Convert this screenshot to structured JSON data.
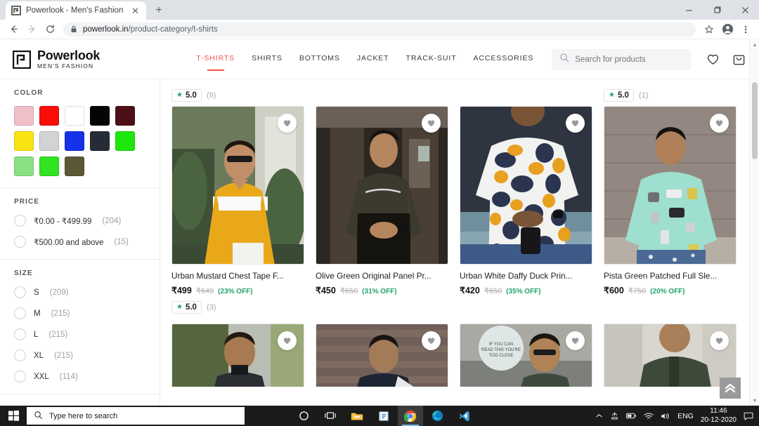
{
  "browser": {
    "tab": {
      "title": "Powerlook - Men's Fashion",
      "favicon_icon": "powerlook-logo-icon",
      "close_icon": "close-icon"
    },
    "new_tab_icon": "plus-icon",
    "window_controls": {
      "minimize": "minimize-icon",
      "maximize": "maximize-icon",
      "close": "close-icon"
    },
    "nav": {
      "back_icon": "arrow-left-icon",
      "forward_icon": "arrow-right-icon",
      "reload_icon": "reload-icon"
    },
    "omnibox": {
      "lock_icon": "lock-icon",
      "host": "powerlook.in",
      "path": "/product-category/t-shirts"
    },
    "toolbar_icons": {
      "bookmark": "star-icon",
      "profile": "account-circle-icon",
      "menu": "three-dot-menu-icon"
    }
  },
  "site": {
    "logo": {
      "name": "Powerlook",
      "tagline": "MEN'S FASHION",
      "mark_icon": "powerlook-monogram-icon"
    },
    "nav_items": [
      {
        "label": "T-SHIRTS",
        "active": true
      },
      {
        "label": "SHIRTS",
        "active": false
      },
      {
        "label": "BOTTOMS",
        "active": false
      },
      {
        "label": "JACKET",
        "active": false
      },
      {
        "label": "TRACK-SUIT",
        "active": false
      },
      {
        "label": "ACCESSORIES",
        "active": false
      }
    ],
    "search": {
      "placeholder": "Search for products",
      "value": "",
      "icon": "search-icon"
    },
    "header_icons": [
      {
        "name": "wishlist-icon"
      },
      {
        "name": "cart-icon"
      }
    ]
  },
  "sidebar": {
    "color": {
      "title": "COLOR",
      "swatches": [
        {
          "name": "pink",
          "hex": "#efc0c8"
        },
        {
          "name": "red",
          "hex": "#fb0d08"
        },
        {
          "name": "white",
          "hex": "#ffffff"
        },
        {
          "name": "black",
          "hex": "#050505"
        },
        {
          "name": "maroon",
          "hex": "#4e1018"
        },
        {
          "name": "yellow",
          "hex": "#f8e412"
        },
        {
          "name": "grey",
          "hex": "#d2d3d5"
        },
        {
          "name": "blue",
          "hex": "#1432e8"
        },
        {
          "name": "navy",
          "hex": "#262b38"
        },
        {
          "name": "green",
          "hex": "#1fe70d"
        },
        {
          "name": "pista-green",
          "hex": "#8ae084"
        },
        {
          "name": "lime-green",
          "hex": "#31e320"
        },
        {
          "name": "olive",
          "hex": "#5c5734"
        }
      ]
    },
    "price": {
      "title": "PRICE",
      "options": [
        {
          "label": "₹0.00 - ₹499.99",
          "count": "(204)"
        },
        {
          "label": "₹500.00 and above",
          "count": "(15)"
        }
      ]
    },
    "size": {
      "title": "SIZE",
      "options": [
        {
          "label": "S",
          "count": "(209)"
        },
        {
          "label": "M",
          "count": "(215)"
        },
        {
          "label": "L",
          "count": "(215)"
        },
        {
          "label": "XL",
          "count": "(215)"
        },
        {
          "label": "XXL",
          "count": "(114)"
        }
      ]
    }
  },
  "main": {
    "top_ratings": [
      {
        "star": "★",
        "value": "5.0",
        "count": "(9)"
      },
      {
        "star": "★",
        "value": "5.0",
        "count": "(1)"
      }
    ],
    "products": [
      {
        "name": "Urban Mustard Chest Tape F...",
        "price": "₹499",
        "mrp": "₹649",
        "discount": "(23% OFF)",
        "rating": {
          "star": "★",
          "value": "5.0",
          "count": "(3)"
        },
        "wishlist_icon": "heart-icon"
      },
      {
        "name": "Olive Green Original Panel Pr...",
        "price": "₹450",
        "mrp": "₹650",
        "discount": "(31% OFF)",
        "rating": null,
        "wishlist_icon": "heart-icon"
      },
      {
        "name": "Urban White Daffy Duck Prin...",
        "price": "₹420",
        "mrp": "₹650",
        "discount": "(35% OFF)",
        "rating": null,
        "wishlist_icon": "heart-icon"
      },
      {
        "name": "Pista Green Patched Full Sle...",
        "price": "₹600",
        "mrp": "₹750",
        "discount": "(20% OFF)",
        "rating": null,
        "wishlist_icon": "heart-icon"
      }
    ],
    "scroll_top_icon": "double-chevron-up-icon"
  },
  "taskbar": {
    "start_icon": "windows-start-icon",
    "search": {
      "placeholder": "Type here to search",
      "icon": "search-icon"
    },
    "apps": [
      {
        "name": "cortana-icon"
      },
      {
        "name": "task-view-icon"
      },
      {
        "name": "file-explorer-icon"
      },
      {
        "name": "microsoft-store-icon"
      },
      {
        "name": "google-chrome-icon",
        "active": true
      },
      {
        "name": "microsoft-edge-icon"
      },
      {
        "name": "vs-code-icon"
      }
    ],
    "tray": {
      "overflow_icon": "chevron-up-icon",
      "onedrive_icon": "onedrive-icon",
      "battery_icon": "battery-icon",
      "wifi_icon": "wifi-icon",
      "volume_icon": "volume-icon",
      "language": "ENG",
      "time": "11:46",
      "date": "20-12-2020",
      "notification_icon": "notification-icon"
    }
  }
}
